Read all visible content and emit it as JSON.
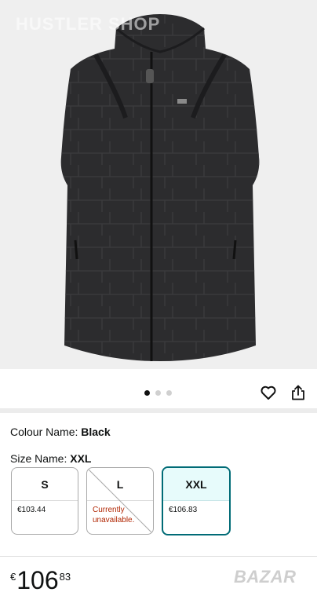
{
  "hero": {
    "watermark_text": "HUSTLER SHOP",
    "image_icon": "vest-product-image",
    "vest_color": "#2c2c2e"
  },
  "gallery": {
    "dots_count": 3,
    "active_index": 0,
    "favorite_icon": "heart-icon",
    "share_icon": "share-icon"
  },
  "attributes": {
    "colour_label": "Colour Name:",
    "colour_value": "Black",
    "size_label": "Size Name:",
    "size_value": "XXL"
  },
  "sizes": [
    {
      "label": "S",
      "price": "€103.44",
      "available": true,
      "selected": false
    },
    {
      "label": "L",
      "status": "Currently unavailable.",
      "status_line1": "Currently",
      "status_line2": "unavailable.",
      "available": false,
      "selected": false
    },
    {
      "label": "XXL",
      "price": "€106.83",
      "available": true,
      "selected": true
    }
  ],
  "price": {
    "currency": "€",
    "whole": "106",
    "fraction": "83"
  },
  "footer": {
    "brand_watermark": "BAZAR"
  },
  "colors": {
    "selected_border": "#006b76",
    "selected_fill": "#e7fbfb",
    "unavailable_text": "#b12704"
  }
}
